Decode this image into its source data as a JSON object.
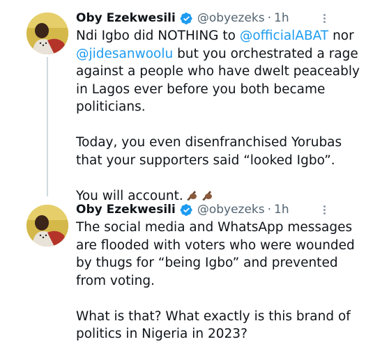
{
  "tweets": [
    {
      "author_name": "Oby Ezekwesili",
      "handle": "@obyezeks",
      "separator": "·",
      "time": "1h",
      "lines": {
        "l1_a": "Ndi Igbo did NOTHING to ",
        "l1_mention": "@officialABAT",
        "l1_b": " nor",
        "l2_mention": "@jidesanwoolu",
        "l2_b": " but you orchestrated a rage",
        "l3": "against a people who have dwelt peaceably",
        "l4": "in Lagos ever before you both became",
        "l5": "politicians.",
        "l6": "Today, you even disenfranchised Yorubas",
        "l7": "that your supporters said “looked Igbo”.",
        "l8": "You will account."
      },
      "emoji": [
        "writing-hand",
        "writing-hand"
      ]
    },
    {
      "author_name": "Oby Ezekwesili",
      "handle": "@obyezeks",
      "separator": "·",
      "time": "1h",
      "lines": {
        "l1": "The social media and WhatsApp messages",
        "l2": "are flooded with voters who were wounded",
        "l3": "by thugs for “being Igbo” and prevented",
        "l4": "from voting.",
        "l5": "What is that? What exactly is this brand of",
        "l6": "politics in Nigeria in 2023?"
      }
    }
  ],
  "colors": {
    "mention": "#1d9bf0",
    "verified": "#1d9bf0",
    "secondary_text": "#536471",
    "thread_line": "#cfd9de"
  }
}
